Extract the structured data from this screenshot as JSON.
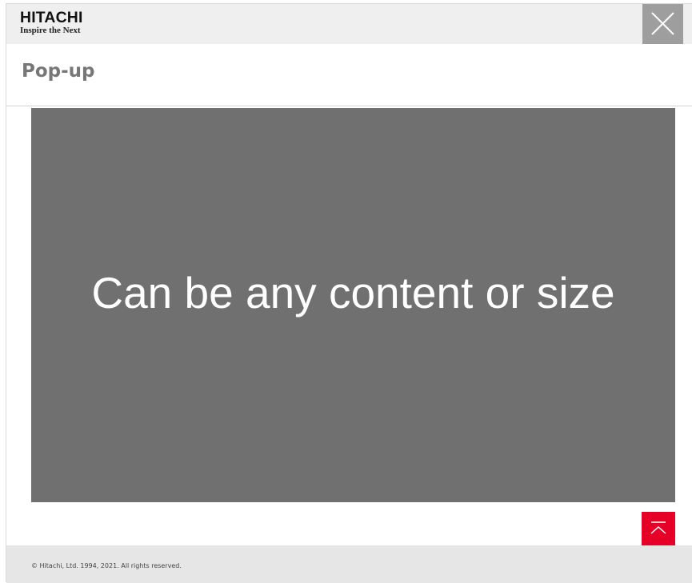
{
  "header": {
    "logo": {
      "wordmark": "HITACHI",
      "tagline": "Inspire the Next",
      "accent_color": "#e60027"
    },
    "close_icon": "close-icon",
    "close_bg_color": "#9e9e9e"
  },
  "page": {
    "title": "Pop-up"
  },
  "content": {
    "placeholder_text": "Can be any content or size",
    "bg_color": "#707070"
  },
  "back_to_top": {
    "icon": "back-to-top-icon",
    "bg_color": "#e60027"
  },
  "footer": {
    "copyright": "© Hitachi, Ltd. 1994, 2021. All rights reserved."
  }
}
